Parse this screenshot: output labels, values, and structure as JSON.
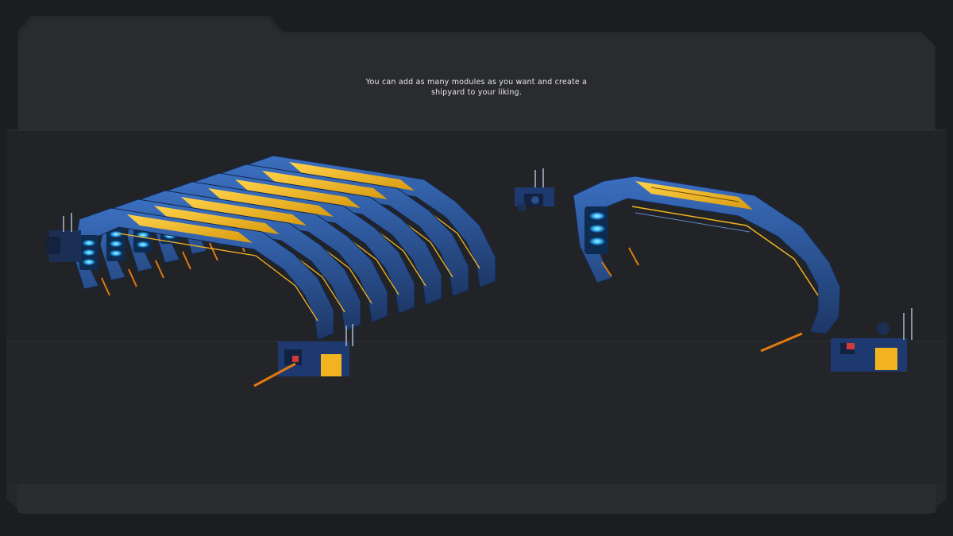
{
  "caption": {
    "line1": "You can add as many modules as you want and create a",
    "line2": "shipyard to your liking."
  },
  "colors": {
    "background": "#1c1d20",
    "panel": "#2a2b2f",
    "panel_band": "#26272b",
    "structure_blue": "#2f5fa8",
    "structure_dark": "#1b2f55",
    "plate_yellow": "#f2b320",
    "glow_cyan": "#37b8ff",
    "accent_orange": "#e07a10",
    "text": "#e8e8e8"
  }
}
